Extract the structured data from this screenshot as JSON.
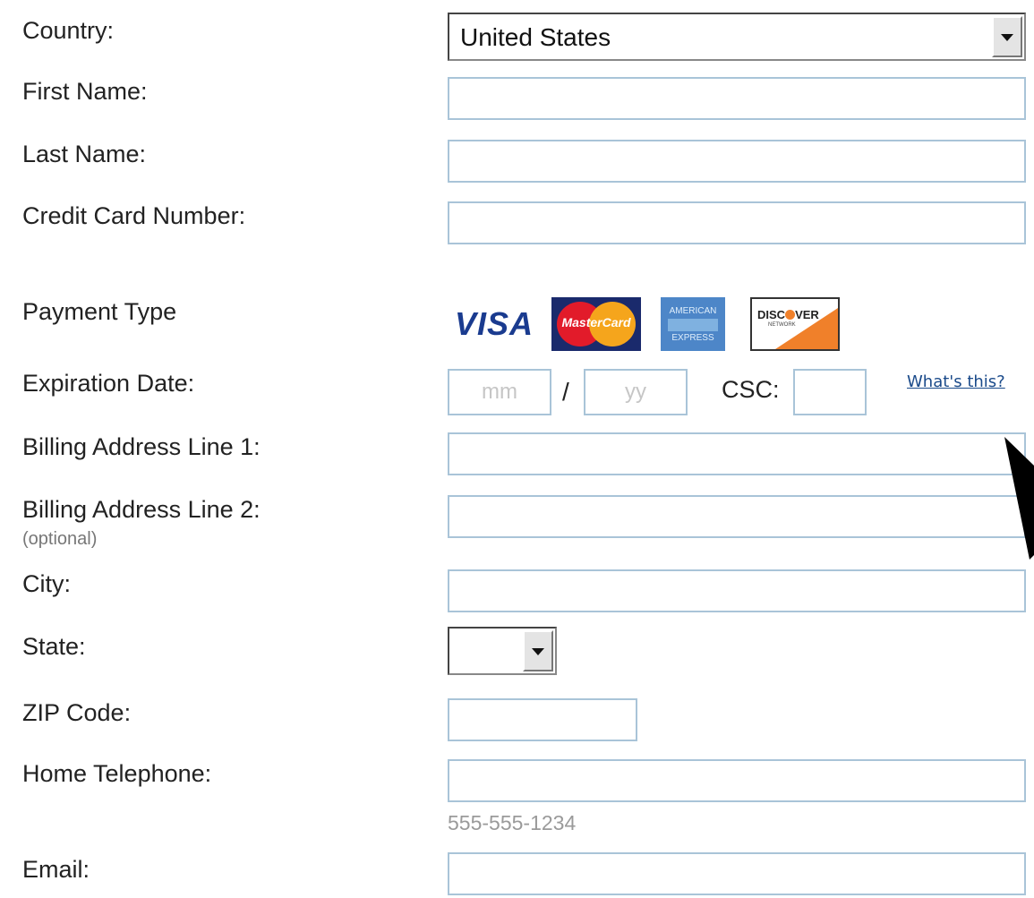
{
  "form": {
    "labels": {
      "country": "Country:",
      "first_name": "First Name:",
      "last_name": "Last Name:",
      "card_number": "Credit Card Number:",
      "payment_type": "Payment Type",
      "expiration": "Expiration Date:",
      "address1": "Billing Address Line 1:",
      "address2": "Billing Address Line 2:",
      "address2_note": "(optional)",
      "city": "City:",
      "state": "State:",
      "zip": "ZIP Code:",
      "phone": "Home Telephone:",
      "email": "Email:"
    },
    "country_value": "United States",
    "state_value": "",
    "expiration": {
      "month_placeholder": "mm",
      "separator": "/",
      "year_placeholder": "yy",
      "csc_label": "CSC:",
      "whats_this": "What's this?"
    },
    "phone_hint": "555-555-1234",
    "cards": {
      "visa": "VISA",
      "mastercard": "MasterCard",
      "amex_top": "AMERICAN",
      "amex_bottom": "EXPRESS",
      "discover": "DISC",
      "discover_tail": "VER",
      "discover_sub": "NETWORK"
    }
  },
  "colors": {
    "field_border": "#a9c4d8",
    "link": "#1a4a8a",
    "hint": "#9a9a9a"
  }
}
